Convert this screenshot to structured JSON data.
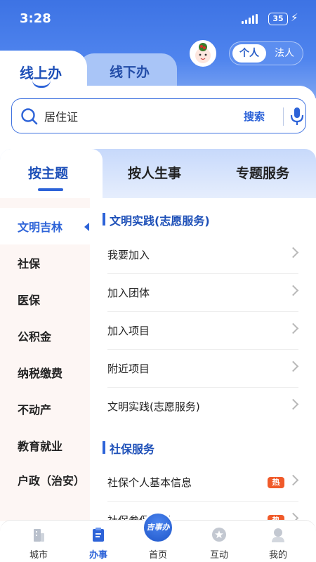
{
  "status": {
    "time": "3:28",
    "battery": "35"
  },
  "header": {
    "role_active": "个人",
    "role_other": "法人",
    "tab_online": "线上办",
    "tab_offline": "线下办"
  },
  "search": {
    "value": "居住证",
    "button": "搜索"
  },
  "categories": [
    "按主题",
    "按人生事",
    "专题服务"
  ],
  "sidebar": {
    "items": [
      {
        "label": "文明吉林",
        "active": true
      },
      {
        "label": "社保"
      },
      {
        "label": "医保"
      },
      {
        "label": "公积金"
      },
      {
        "label": "纳税缴费"
      },
      {
        "label": "不动产"
      },
      {
        "label": "教育就业"
      },
      {
        "label": "户政（治安）"
      }
    ]
  },
  "sections": [
    {
      "title": "文明实践(志愿服务)",
      "rows": [
        "我要加入",
        "加入团体",
        "加入项目",
        "附近项目",
        "文明实践(志愿服务)"
      ]
    },
    {
      "title": "社保服务",
      "rows": [
        "社保个人基本信息",
        "社保参保证明"
      ],
      "hot_badge": "热"
    }
  ],
  "bottom_nav": {
    "items": [
      "城市",
      "办事",
      "首页",
      "互动",
      "我的"
    ],
    "active": "办事",
    "home_badge": "吉事办"
  },
  "colors": {
    "primary": "#2d63d8",
    "hot": "#f05a2a",
    "sidebar_bg": "#fdf6f4"
  }
}
